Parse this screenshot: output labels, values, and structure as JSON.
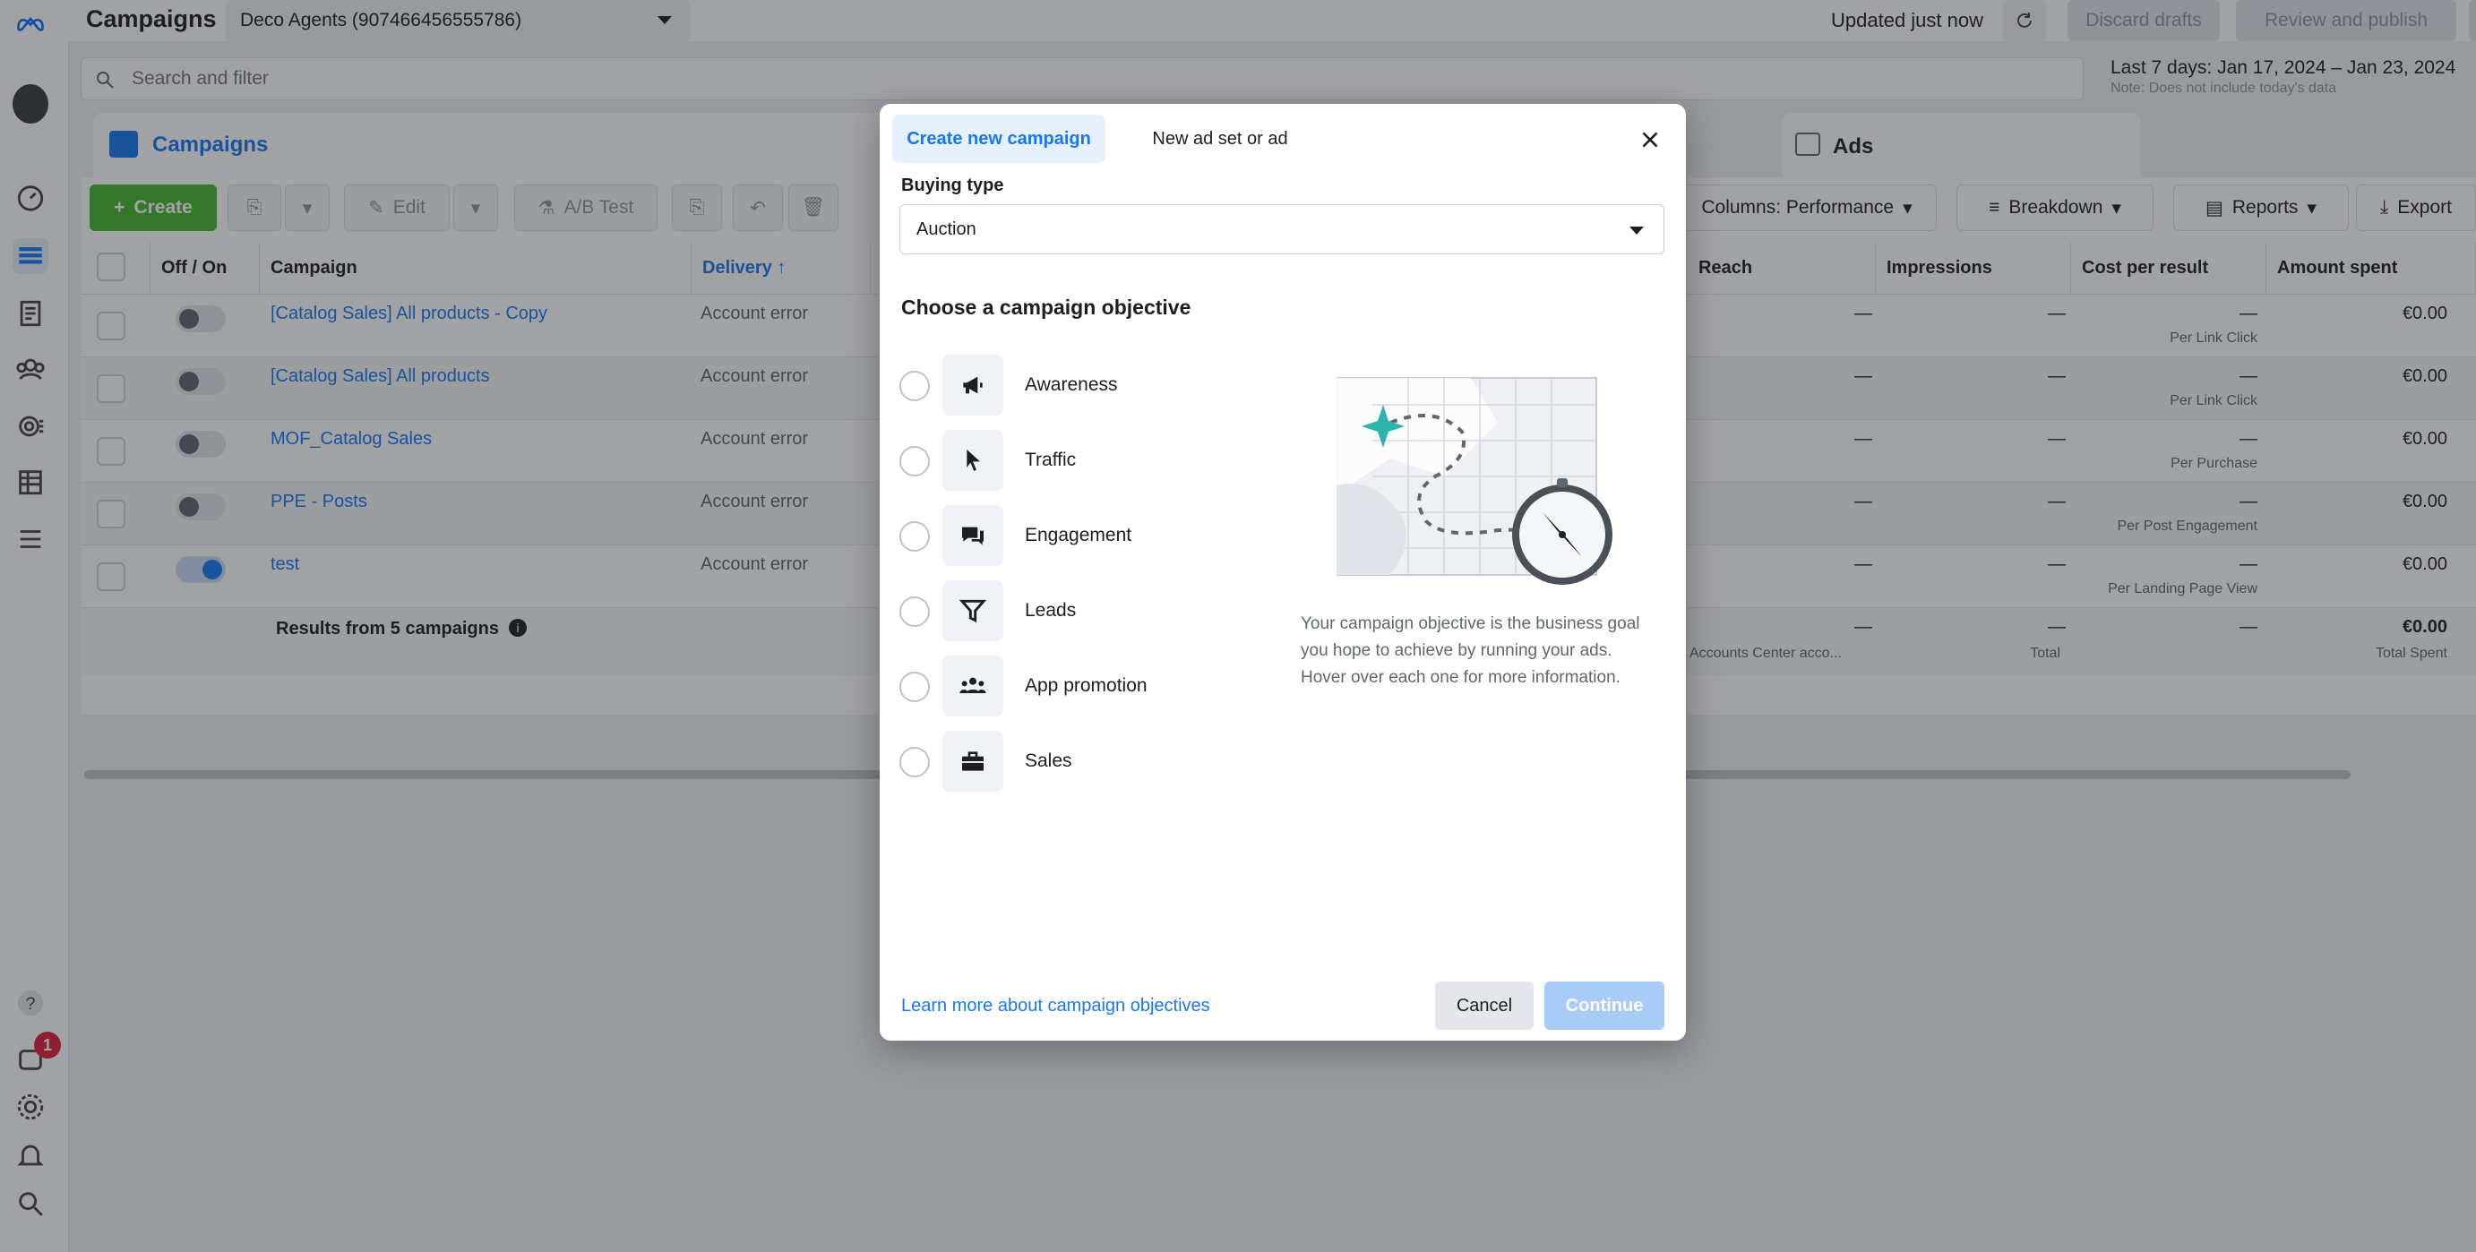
{
  "topbar": {
    "page_title": "Campaigns",
    "account": "Deco Agents (907466456555786)",
    "updated": "Updated just now",
    "discard": "Discard drafts",
    "review": "Review and publish",
    "more": "⋯"
  },
  "search": {
    "placeholder": "Search and filter"
  },
  "date": {
    "range": "Last 7 days: Jan 17, 2024 – Jan 23, 2024",
    "note": "Note: Does not include today's data"
  },
  "tabs": {
    "campaigns": "Campaigns",
    "ads": "Ads"
  },
  "toolbar": {
    "create": "Create",
    "edit": "Edit",
    "ab_test": "A/B Test",
    "columns": "Columns: Performance",
    "breakdown": "Breakdown",
    "reports": "Reports",
    "export": "Export"
  },
  "table": {
    "headers": {
      "offon": "Off / On",
      "campaign": "Campaign",
      "delivery": "Delivery ↑",
      "reach": "Reach",
      "impressions": "Impressions",
      "cost": "Cost per result",
      "spent": "Amount spent"
    },
    "rows": [
      {
        "name": "[Catalog Sales] All products - Copy",
        "delivery": "Account error",
        "reach": "—",
        "impressions": "—",
        "cost": "—",
        "cost_sub": "Per Link Click",
        "spent": "€0.00",
        "on": false
      },
      {
        "name": "[Catalog Sales] All products",
        "delivery": "Account error",
        "reach": "—",
        "impressions": "—",
        "cost": "—",
        "cost_sub": "Per Link Click",
        "spent": "€0.00",
        "on": false
      },
      {
        "name": "MOF_Catalog Sales",
        "delivery": "Account error",
        "reach": "—",
        "impressions": "—",
        "cost": "—",
        "cost_sub": "Per Purchase",
        "spent": "€0.00",
        "on": false
      },
      {
        "name": "PPE - Posts",
        "delivery": "Account error",
        "reach": "—",
        "impressions": "—",
        "cost": "—",
        "cost_sub": "Per Post Engagement",
        "spent": "€0.00",
        "on": false
      },
      {
        "name": "test",
        "delivery": "Account error",
        "reach": "—",
        "impressions": "—",
        "cost": "—",
        "cost_sub": "Per Landing Page View",
        "spent": "€0.00",
        "on": true
      }
    ],
    "summary": {
      "label": "Results from 5 campaigns",
      "reach": "—",
      "reach_sub": "Accounts Center acco...",
      "impressions": "—",
      "impressions_sub": "Total",
      "cost": "—",
      "spent": "€0.00",
      "spent_sub": "Total Spent"
    }
  },
  "rail": {
    "badge": "1"
  },
  "modal": {
    "tab_create": "Create new campaign",
    "tab_new": "New ad set or ad",
    "buying_label": "Buying type",
    "buying_value": "Auction",
    "objective_heading": "Choose a campaign objective",
    "objectives": [
      {
        "label": "Awareness",
        "icon": "megaphone-icon"
      },
      {
        "label": "Traffic",
        "icon": "cursor-icon"
      },
      {
        "label": "Engagement",
        "icon": "chat-bubbles-icon"
      },
      {
        "label": "Leads",
        "icon": "funnel-icon"
      },
      {
        "label": "App promotion",
        "icon": "people-icon"
      },
      {
        "label": "Sales",
        "icon": "briefcase-icon"
      }
    ],
    "description": "Your campaign objective is the business goal you hope to achieve by running your ads. Hover over each one for more information.",
    "learn_more": "Learn more about campaign objectives",
    "cancel": "Cancel",
    "continue": "Continue"
  },
  "colors": {
    "accent": "#1877f2",
    "create_green": "#42b72a",
    "continue_disabled": "#a9cbf7",
    "badge_red": "#e41e3f"
  }
}
